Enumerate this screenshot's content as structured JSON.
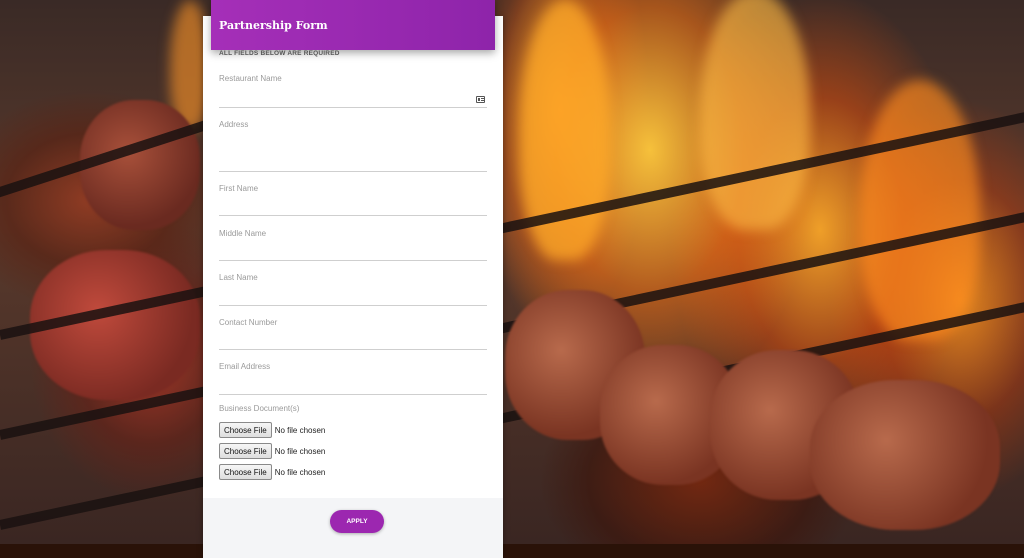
{
  "form": {
    "title": "Partnership Form",
    "required_note": "ALL FIELDS BELOW ARE REQUIRED",
    "fields": [
      {
        "label": "Restaurant Name",
        "value": ""
      },
      {
        "label": "Address",
        "value": ""
      },
      {
        "label": "First Name",
        "value": ""
      },
      {
        "label": "Middle Name",
        "value": ""
      },
      {
        "label": "Last Name",
        "value": ""
      },
      {
        "label": "Contact Number",
        "value": ""
      },
      {
        "label": "Email Address",
        "value": ""
      }
    ],
    "documents": {
      "label": "Business Document(s)",
      "files": [
        {
          "button": "Choose File",
          "status": "No file chosen"
        },
        {
          "button": "Choose File",
          "status": "No file chosen"
        },
        {
          "button": "Choose File",
          "status": "No file chosen"
        }
      ]
    },
    "submit_label": "APPLY"
  },
  "icons": {
    "restaurant_name": "contact-card-icon"
  },
  "colors": {
    "accent": "#9c27b0",
    "header_gradient_start": "#a52fb8",
    "header_gradient_end": "#8e24aa"
  }
}
